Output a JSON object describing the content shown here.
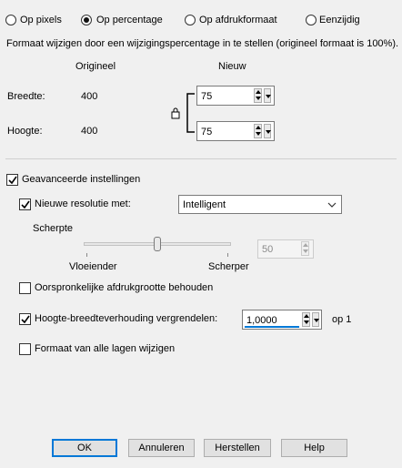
{
  "mode_radios": [
    {
      "label": "Op pixels",
      "selected": false
    },
    {
      "label": "Op percentage",
      "selected": true
    },
    {
      "label": "Op afdrukformaat",
      "selected": false
    },
    {
      "label": "Eenzijdig",
      "selected": false
    }
  ],
  "description": "Formaat wijzigen door een wijzigingspercentage in te stellen (origineel formaat  is 100%).",
  "columns": {
    "original": "Origineel",
    "new": "Nieuw"
  },
  "width": {
    "label": "Breedte:",
    "original": "400",
    "new": "75"
  },
  "height": {
    "label": "Hoogte:",
    "original": "400",
    "new": "75"
  },
  "advanced": {
    "label": "Geavanceerde instellingen",
    "checked": true,
    "resolution": {
      "label": "Nieuwe resolutie met:",
      "checked": true,
      "method": "Intelligent"
    },
    "sharpness": {
      "label": "Scherpte",
      "left_label": "Vloeiender",
      "right_label": "Scherper",
      "value": "50",
      "level": 0.5
    },
    "keep_print_size": {
      "label": "Oorspronkelijke afdrukgrootte behouden",
      "checked": false
    },
    "aspect": {
      "label": "Hoogte-breedteverhouding vergrendelen:",
      "checked": true,
      "value": "1,0000",
      "suffix": "op 1"
    },
    "all_layers": {
      "label": "Formaat van alle lagen wijzigen",
      "checked": false
    }
  },
  "buttons": {
    "ok": "OK",
    "cancel": "Annuleren",
    "reset": "Herstellen",
    "help": "Help"
  },
  "colors": {
    "focus_accent": "#0078d7"
  }
}
